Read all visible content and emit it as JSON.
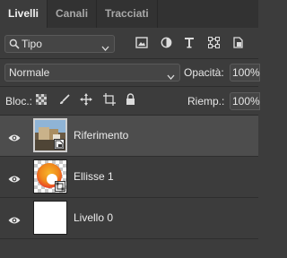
{
  "tabs": [
    {
      "label": "Livelli"
    },
    {
      "label": "Canali"
    },
    {
      "label": "Tracciati"
    }
  ],
  "filter": {
    "kind_label": "Tipo",
    "icons": [
      "image-filter-icon",
      "adjustment-filter-icon",
      "type-filter-icon",
      "shape-filter-icon",
      "smart-object-filter-icon"
    ]
  },
  "blend": {
    "mode": "Normale",
    "opacity_label": "Opacità:",
    "opacity_value": "100%"
  },
  "lock": {
    "label": "Bloc.:",
    "icons": [
      "lock-transparency-icon",
      "lock-image-pixels-icon",
      "lock-position-icon",
      "lock-artboard-icon",
      "lock-all-icon"
    ],
    "fill_label": "Riemp.:",
    "fill_value": "100%"
  },
  "layers": [
    {
      "name": "Riferimento",
      "selected": true,
      "visible": true,
      "thumb": "photo",
      "badge": "smart-object-icon"
    },
    {
      "name": "Ellisse 1",
      "selected": false,
      "visible": true,
      "thumb": "ellipse",
      "badge": "shape-layer-icon"
    },
    {
      "name": "Livello 0",
      "selected": false,
      "visible": true,
      "thumb": "white"
    }
  ],
  "colors": {
    "panel_bg": "#3c3c3c",
    "tab_bar_bg": "#323232",
    "selected_row": "#4d4d4d",
    "ellipse_orange": "#f08a1c",
    "ellipse_red": "#e8402a"
  }
}
